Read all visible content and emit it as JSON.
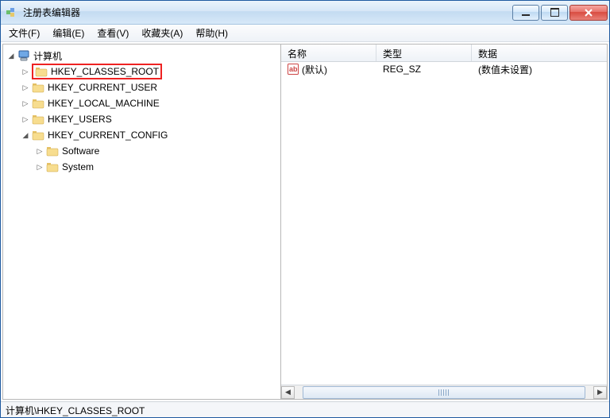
{
  "window": {
    "title": "注册表编辑器"
  },
  "menu": {
    "file": "文件(F)",
    "edit": "编辑(E)",
    "view": "查看(V)",
    "favorites": "收藏夹(A)",
    "help": "帮助(H)"
  },
  "tree": {
    "root": "计算机",
    "hives": {
      "hkcr": "HKEY_CLASSES_ROOT",
      "hkcu": "HKEY_CURRENT_USER",
      "hklm": "HKEY_LOCAL_MACHINE",
      "hku": "HKEY_USERS",
      "hkcc": "HKEY_CURRENT_CONFIG"
    },
    "hkcc_children": {
      "software": "Software",
      "system": "System"
    }
  },
  "list": {
    "headers": {
      "name": "名称",
      "type": "类型",
      "data": "数据"
    },
    "rows": [
      {
        "name": "(默认)",
        "type": "REG_SZ",
        "data": "(数值未设置)"
      }
    ]
  },
  "statusbar": {
    "path": "计算机\\HKEY_CLASSES_ROOT"
  }
}
